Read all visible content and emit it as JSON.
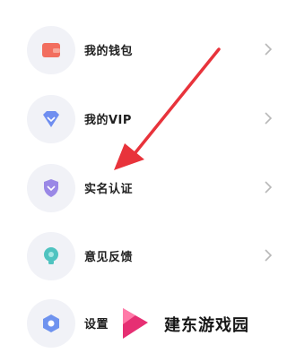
{
  "menu": {
    "items": [
      {
        "label": "我的钱包",
        "icon": "wallet-icon"
      },
      {
        "label": "我的VIP",
        "icon": "vip-diamond-icon"
      },
      {
        "label": "实名认证",
        "icon": "shield-icon"
      },
      {
        "label": "意见反馈",
        "icon": "lightbulb-icon"
      },
      {
        "label": "设置",
        "icon": "gear-icon"
      }
    ]
  },
  "watermark": {
    "text": "建东游戏园"
  },
  "colors": {
    "accent_red": "#e8333b",
    "icon_bg": "#f1f2f7"
  }
}
